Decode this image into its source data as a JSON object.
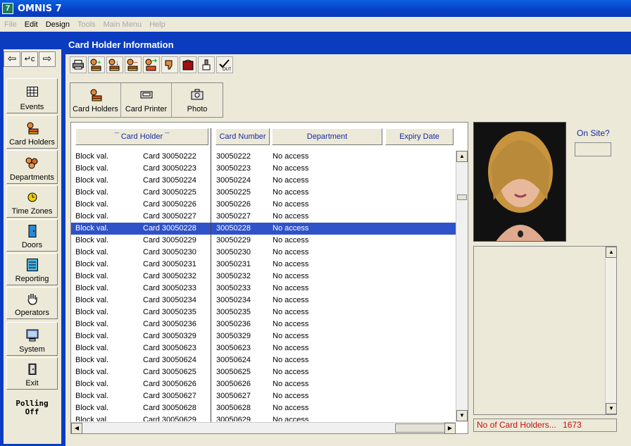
{
  "app": {
    "title": "OMNIS 7",
    "icon_letter": "7"
  },
  "menu": {
    "items": [
      {
        "label": "File",
        "enabled": false
      },
      {
        "label": "Edit",
        "enabled": true
      },
      {
        "label": "Design",
        "enabled": true
      },
      {
        "label": "Tools",
        "enabled": false
      },
      {
        "label": "Main Menu",
        "enabled": false
      },
      {
        "label": "Help",
        "enabled": false
      }
    ]
  },
  "nav": {
    "arrows": [
      "back-arrow-icon",
      "return-icon",
      "forward-arrow-icon"
    ],
    "buttons": [
      {
        "label": "Events",
        "icon": "events-grid-icon"
      },
      {
        "label": "Card Holders",
        "icon": "card-holder-icon"
      },
      {
        "label": "Departments",
        "icon": "departments-icon"
      },
      {
        "label": "Time Zones",
        "icon": "clock-icon"
      },
      {
        "label": "Doors",
        "icon": "door-icon"
      },
      {
        "label": "Reporting",
        "icon": "report-icon"
      },
      {
        "label": "Operators",
        "icon": "hand-icon"
      },
      {
        "label": "System",
        "icon": "computer-icon"
      },
      {
        "label": "Exit",
        "icon": "exit-door-icon"
      }
    ],
    "polling_line1": "Polling",
    "polling_line2": "Off"
  },
  "window": {
    "title": "Card Holder Information",
    "toolbar_icons": [
      "print-icon",
      "add-card-icon",
      "insert-card-icon",
      "remove-card-icon",
      "transfer-card-icon",
      "thumbs-down-icon",
      "red-card-icon",
      "brush-icon",
      "check-out-icon"
    ],
    "tabs": [
      {
        "label": "Card Holders",
        "icon": "card-holder-icon"
      },
      {
        "label": "Card Printer",
        "icon": "card-printer-icon"
      },
      {
        "label": "Photo",
        "icon": "camera-icon"
      }
    ],
    "columns": {
      "card_holder": "¯ Card Holder ¯",
      "card_number": "Card Number",
      "department": "Department",
      "expiry_date": "Expiry Date"
    },
    "rows": [
      {
        "status": "Block val.",
        "holder": "Card 30050222",
        "number": "30050222",
        "dept": "No access",
        "selected": false
      },
      {
        "status": "Block val.",
        "holder": "Card 30050223",
        "number": "30050223",
        "dept": "No access",
        "selected": false
      },
      {
        "status": "Block val.",
        "holder": "Card 30050224",
        "number": "30050224",
        "dept": "No access",
        "selected": false
      },
      {
        "status": "Block val.",
        "holder": "Card 30050225",
        "number": "30050225",
        "dept": "No access",
        "selected": false
      },
      {
        "status": "Block val.",
        "holder": "Card 30050226",
        "number": "30050226",
        "dept": "No access",
        "selected": false
      },
      {
        "status": "Block val.",
        "holder": "Card 30050227",
        "number": "30050227",
        "dept": "No access",
        "selected": false
      },
      {
        "status": "Block val.",
        "holder": "Card 30050228",
        "number": "30050228",
        "dept": "No access",
        "selected": true
      },
      {
        "status": "Block val.",
        "holder": "Card 30050229",
        "number": "30050229",
        "dept": "No access",
        "selected": false
      },
      {
        "status": "Block val.",
        "holder": "Card 30050230",
        "number": "30050230",
        "dept": "No access",
        "selected": false
      },
      {
        "status": "Block val.",
        "holder": "Card 30050231",
        "number": "30050231",
        "dept": "No access",
        "selected": false
      },
      {
        "status": "Block val.",
        "holder": "Card 30050232",
        "number": "30050232",
        "dept": "No access",
        "selected": false
      },
      {
        "status": "Block val.",
        "holder": "Card 30050233",
        "number": "30050233",
        "dept": "No access",
        "selected": false
      },
      {
        "status": "Block val.",
        "holder": "Card 30050234",
        "number": "30050234",
        "dept": "No access",
        "selected": false
      },
      {
        "status": "Block val.",
        "holder": "Card 30050235",
        "number": "30050235",
        "dept": "No access",
        "selected": false
      },
      {
        "status": "Block val.",
        "holder": "Card 30050236",
        "number": "30050236",
        "dept": "No access",
        "selected": false
      },
      {
        "status": "Block val.",
        "holder": "Card 30050329",
        "number": "30050329",
        "dept": "No access",
        "selected": false
      },
      {
        "status": "Block val.",
        "holder": "Card 30050623",
        "number": "30050623",
        "dept": "No access",
        "selected": false
      },
      {
        "status": "Block val.",
        "holder": "Card 30050624",
        "number": "30050624",
        "dept": "No access",
        "selected": false
      },
      {
        "status": "Block val.",
        "holder": "Card 30050625",
        "number": "30050625",
        "dept": "No access",
        "selected": false
      },
      {
        "status": "Block val.",
        "holder": "Card 30050626",
        "number": "30050626",
        "dept": "No access",
        "selected": false
      },
      {
        "status": "Block val.",
        "holder": "Card 30050627",
        "number": "30050627",
        "dept": "No access",
        "selected": false
      },
      {
        "status": "Block val.",
        "holder": "Card 30050628",
        "number": "30050628",
        "dept": "No access",
        "selected": false
      },
      {
        "status": "Block val.",
        "holder": "Card 30050629",
        "number": "30050629",
        "dept": "No access",
        "selected": false
      }
    ],
    "on_site_label": "On Site?",
    "on_site_value": "",
    "count_label": "No of Card Holders...",
    "count_value": "1673"
  },
  "colors": {
    "titlebar": "#0a4fd8",
    "panel_blue": "#0b3cbf",
    "selection": "#2f52c9",
    "header_text": "#1a2aa0",
    "count_text": "#c01010"
  }
}
